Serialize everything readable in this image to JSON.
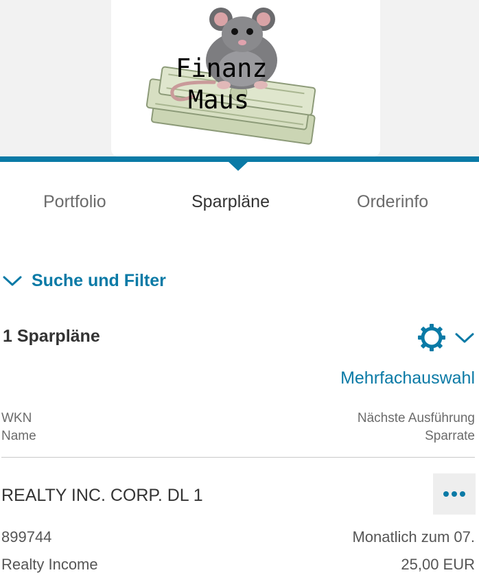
{
  "logo": {
    "text_line1": "Finanz",
    "text_line2": "Maus"
  },
  "tabs": [
    {
      "label": "Portfolio",
      "active": false
    },
    {
      "label": "Sparpläne",
      "active": true
    },
    {
      "label": "Orderinfo",
      "active": false
    }
  ],
  "filter": {
    "label": "Suche und Filter",
    "icon": "chevron-down-icon"
  },
  "list": {
    "count_title": "1 Sparpläne",
    "settings_icon": "gear-icon",
    "settings_dropdown_icon": "chevron-down-icon",
    "multi_select_label": "Mehrfachauswahl",
    "columns": {
      "left": [
        "WKN",
        "Name"
      ],
      "right": [
        "Nächste Ausführung",
        "Sparrate"
      ]
    },
    "items": [
      {
        "title": "REALTY INC. CORP. DL 1",
        "wkn": "899744",
        "name": "Realty Income",
        "next_execution": "Monatlich zum 07.",
        "rate": "25,00 EUR",
        "more_icon": "more-dots-icon"
      }
    ]
  },
  "colors": {
    "accent": "#0a7aa6",
    "header_bg": "#f2f2f2",
    "text_dark": "#333333",
    "text_muted": "#6b6b6b"
  }
}
